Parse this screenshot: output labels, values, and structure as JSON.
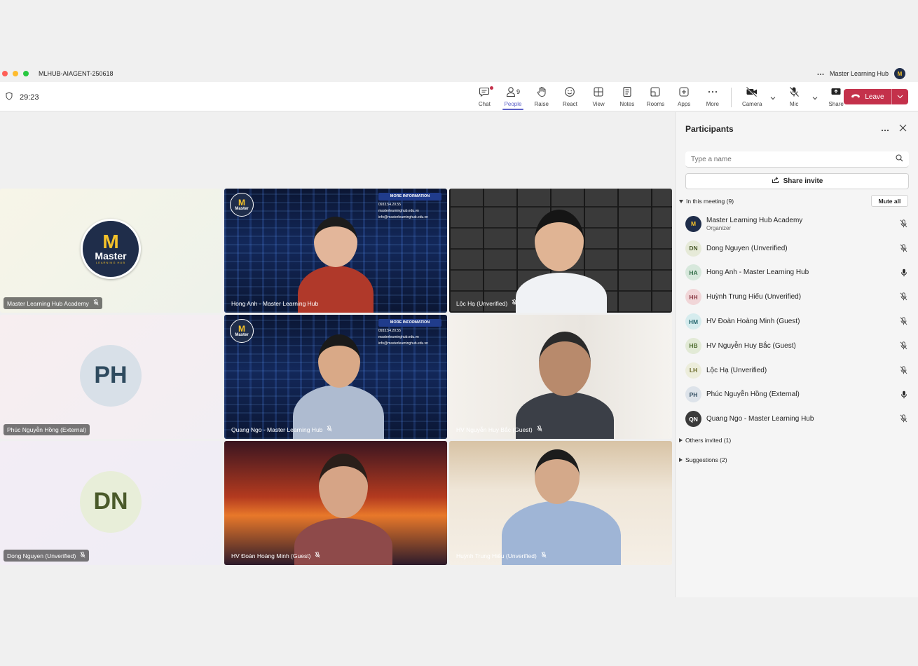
{
  "window": {
    "title": "MLHUB-AIAGENT-250618",
    "org_name": "Master Learning Hub",
    "org_avatar": "M"
  },
  "toolbar": {
    "timer": "29:23",
    "people_count": "9",
    "tools": [
      {
        "id": "chat",
        "label": "Chat",
        "icon": "chat-icon"
      },
      {
        "id": "people",
        "label": "People",
        "icon": "people-icon"
      },
      {
        "id": "raise",
        "label": "Raise",
        "icon": "hand-icon"
      },
      {
        "id": "react",
        "label": "React",
        "icon": "smiley-icon"
      },
      {
        "id": "view",
        "label": "View",
        "icon": "grid-icon"
      },
      {
        "id": "notes",
        "label": "Notes",
        "icon": "notes-icon"
      },
      {
        "id": "rooms",
        "label": "Rooms",
        "icon": "rooms-icon"
      },
      {
        "id": "apps",
        "label": "Apps",
        "icon": "apps-icon"
      },
      {
        "id": "more",
        "label": "More",
        "icon": "more-icon"
      }
    ],
    "camera_label": "Camera",
    "mic_label": "Mic",
    "share_label": "Share",
    "leave_label": "Leave",
    "accent": "#5b5fc7",
    "leave_color": "#c4314b"
  },
  "tiles": [
    {
      "name": "Master Learning Hub Academy",
      "logo": {
        "m": "M",
        "word": "Master",
        "sub": "LEARNING HUB"
      }
    },
    {
      "name": "Hong Anh - Master Learning Hub",
      "card": {
        "title": "MORE INFORMATION",
        "phone": "0933.54.20.55",
        "web": "masterlearninghub.edu.vn",
        "email": "info@masterlearninghub.edu.vn"
      },
      "mini_logo": {
        "m": "M",
        "word": "Master"
      }
    },
    {
      "name": "Lộc Hạ (Unverified)"
    },
    {
      "name": "Phúc Nguyễn Hồng (External)",
      "initials": "PH"
    },
    {
      "name": "Quang Ngo - Master Learning Hub",
      "card": {
        "title": "MORE INFORMATION",
        "phone": "0933.54.20.55",
        "web": "masterlearninghub.edu.vn",
        "email": "info@masterlearninghub.edu.vn"
      },
      "mini_logo": {
        "m": "M",
        "word": "Master"
      }
    },
    {
      "name": "HV Nguyễn Huy Bắc (Guest)"
    },
    {
      "name": "Dong Nguyen (Unverified)",
      "initials": "DN"
    },
    {
      "name": "HV Đoàn Hoàng Minh (Guest)"
    },
    {
      "name": "Huỳnh Trung Hiếu (Unverified)"
    }
  ],
  "panel": {
    "title": "Participants",
    "search_placeholder": "Type a name",
    "share_invite": "Share invite",
    "in_meeting": "In this meeting (9)",
    "mute_all": "Mute all",
    "others_invited": "Others invited (1)",
    "suggestions": "Suggestions (2)",
    "participants": [
      {
        "initials": "M",
        "name": "Master Learning Hub Academy",
        "role": "Organizer",
        "avatar_bg": "#1f2d4a",
        "avatar_fg": "#f5c22a",
        "muted": true
      },
      {
        "initials": "DN",
        "name": "Dong Nguyen (Unverified)",
        "role": "",
        "avatar_bg": "#e6ead8",
        "avatar_fg": "#4a5a2a",
        "muted": true
      },
      {
        "initials": "HA",
        "name": "Hong Anh - Master Learning Hub",
        "role": "",
        "avatar_bg": "#d7e8dc",
        "avatar_fg": "#2e6b45",
        "muted": false
      },
      {
        "initials": "HH",
        "name": "Huỳnh Trung Hiếu (Unverified)",
        "role": "",
        "avatar_bg": "#f1d6d8",
        "avatar_fg": "#8a3a44",
        "muted": true
      },
      {
        "initials": "HM",
        "name": "HV Đoàn Hoàng Minh (Guest)",
        "role": "",
        "avatar_bg": "#d6ecee",
        "avatar_fg": "#2a6b72",
        "muted": true
      },
      {
        "initials": "HB",
        "name": "HV Nguyễn Huy Bắc (Guest)",
        "role": "",
        "avatar_bg": "#e2ead6",
        "avatar_fg": "#4b6a2c",
        "muted": true
      },
      {
        "initials": "LH",
        "name": "Lộc Hạ (Unverified)",
        "role": "",
        "avatar_bg": "#eceddb",
        "avatar_fg": "#6a6a2a",
        "muted": true
      },
      {
        "initials": "PH",
        "name": "Phúc Nguyễn Hồng (External)",
        "role": "",
        "avatar_bg": "#dde3ea",
        "avatar_fg": "#2e4a5e",
        "muted": false
      },
      {
        "initials": "QN",
        "name": "Quang Ngo - Master Learning Hub",
        "role": "",
        "avatar_bg": "#3a3a3a",
        "avatar_fg": "#ffffff",
        "muted": true
      }
    ]
  }
}
